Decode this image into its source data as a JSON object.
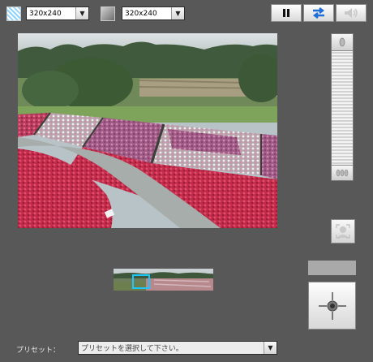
{
  "top_bar": {
    "resolution_left": {
      "value": "320x240"
    },
    "resolution_right": {
      "value": "320x240"
    }
  },
  "controls": {
    "pause": {
      "icon": "pause-icon"
    },
    "refresh": {
      "icon": "swap-arrows-icon"
    },
    "audio": {
      "icon": "speaker-icon"
    }
  },
  "zoom": {
    "in_icon": "zoom-in-icon",
    "out_icon": "zoom-out-icon"
  },
  "preset": {
    "label": "プリセット：",
    "placeholder": "プリセットを選択して下さい。"
  },
  "colors": {
    "background": "#585858",
    "accent_blue": "#1f6fd6",
    "panorama_frame": "#19c8ff"
  }
}
